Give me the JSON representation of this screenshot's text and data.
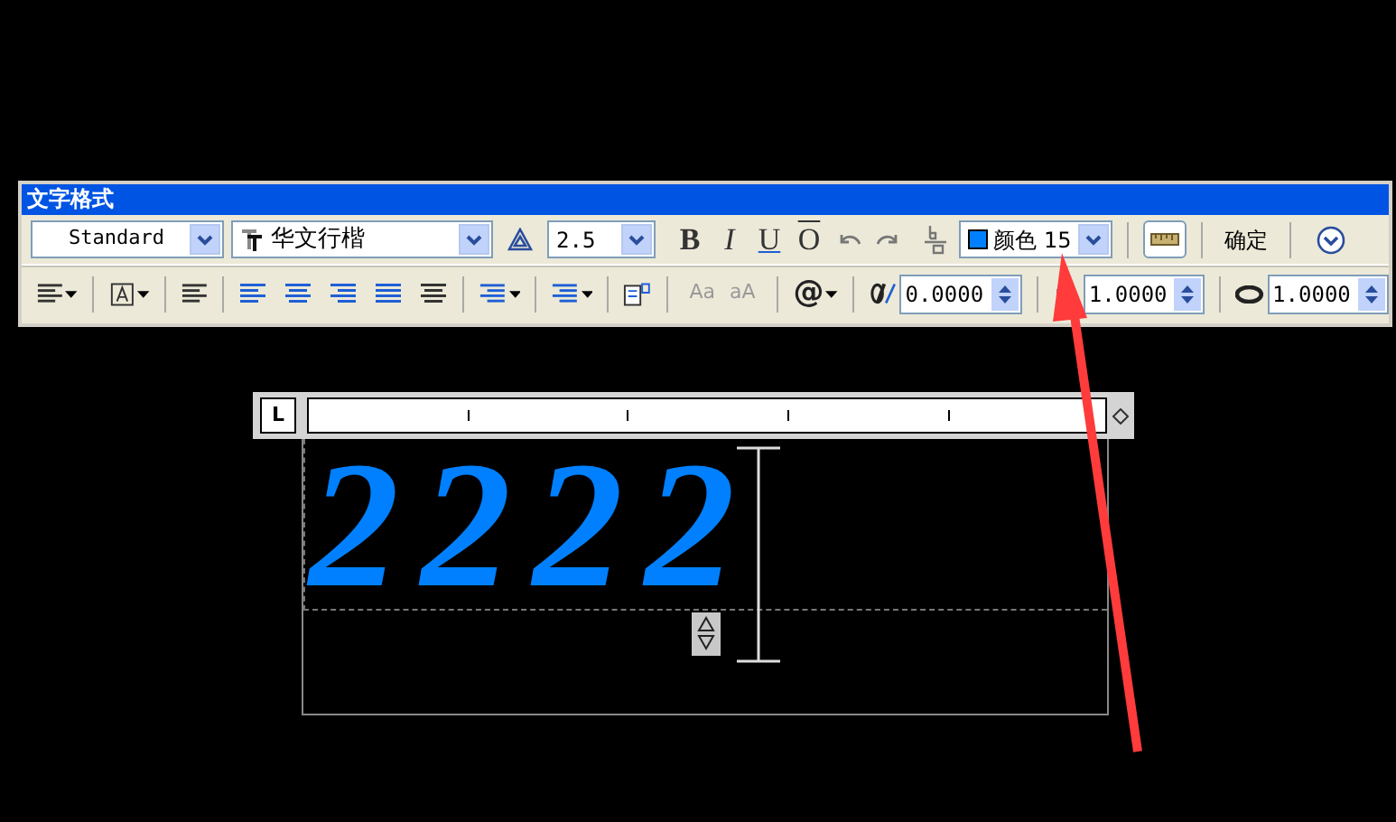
{
  "toolbar": {
    "title": "文字格式",
    "style": {
      "value": "Standard"
    },
    "font": {
      "value": "华文行楷"
    },
    "height": {
      "value": "2.5"
    },
    "format_buttons": [
      {
        "label": "B",
        "kind": "bold"
      },
      {
        "label": "I",
        "kind": "italic"
      },
      {
        "label": "U",
        "kind": "underline"
      },
      {
        "label": "O",
        "kind": "overline"
      }
    ],
    "color": {
      "label": "颜色",
      "value": "15",
      "color": "#0080ff"
    },
    "ok_button": "确定",
    "case_buttons": [
      "Aa",
      "aA"
    ],
    "symbol_button": "@",
    "oblique": {
      "value": "0.0000"
    },
    "tracking": {
      "value": "1.0000"
    },
    "width_factor": {
      "value": "1.0000"
    }
  },
  "editor": {
    "ruler_tab": "L",
    "text": "2222"
  }
}
